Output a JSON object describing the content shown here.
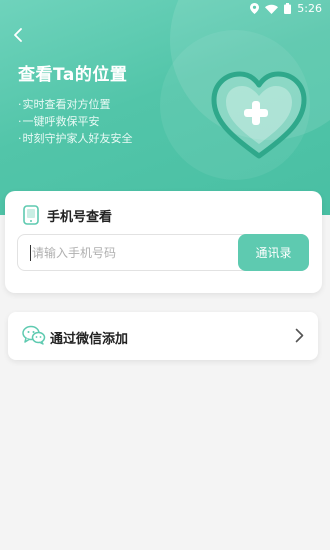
{
  "status_bar": {
    "time": "5:26"
  },
  "header": {
    "title": "查看Ta的位置",
    "features": [
      "实时查看对方位置",
      "一键呼救保平安",
      "时刻守护家人好友安全"
    ]
  },
  "phone_search": {
    "label": "手机号查看",
    "input_placeholder": "请输入手机号码",
    "input_value": "",
    "contacts_button": "通讯录"
  },
  "wechat_add": {
    "label": "通过微信添加"
  },
  "colors": {
    "accent": "#5ecab0",
    "header_bg": "#52c5a9",
    "page_bg": "#f4f4f4"
  },
  "icons": {
    "back": "chevron-left-icon",
    "phone": "phone-icon",
    "wechat": "wechat-icon",
    "heart": "heart-plus-illustration",
    "chevron": "chevron-right-icon"
  }
}
